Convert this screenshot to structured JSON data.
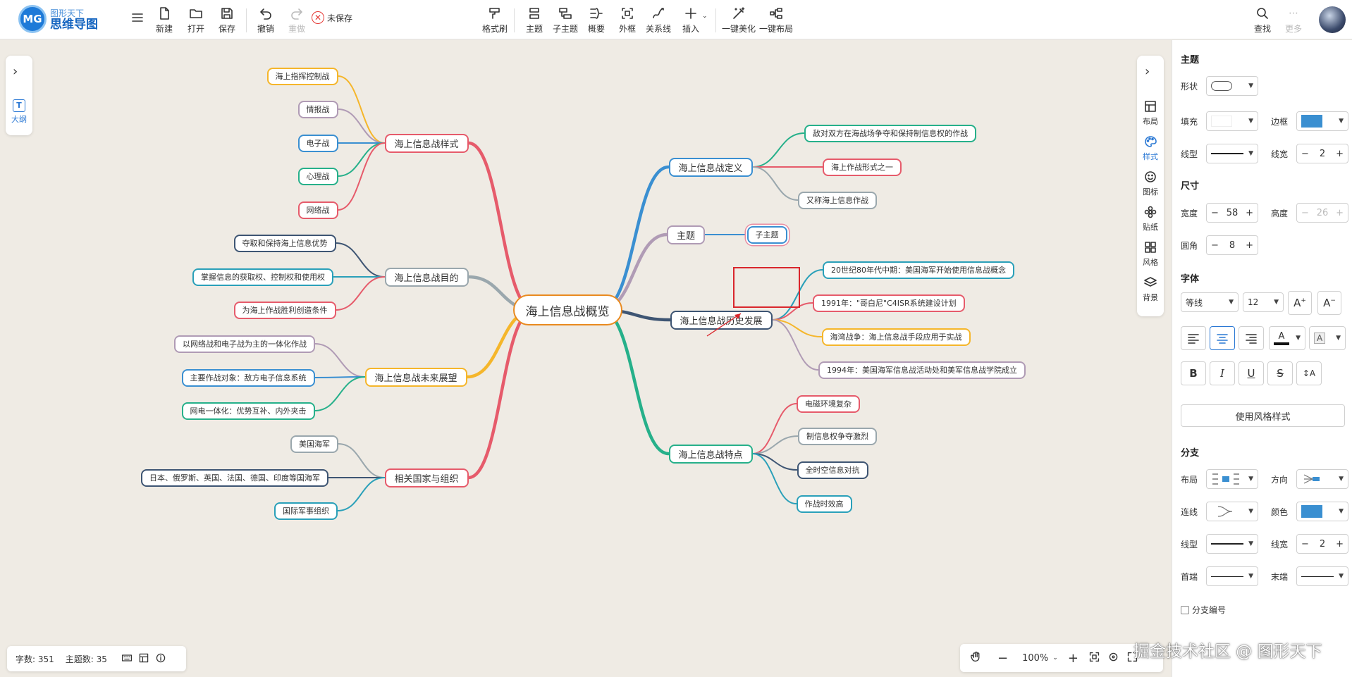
{
  "app": {
    "logo_mark": "MG",
    "logo_line1": "图形天下",
    "logo_line2": "思维导图"
  },
  "toolbar": {
    "new": "新建",
    "open": "打开",
    "save": "保存",
    "undo": "撤销",
    "redo": "重做",
    "unsaved": "未保存",
    "format_painter": "格式刷",
    "topic": "主题",
    "subtopic": "子主题",
    "summary": "概要",
    "boundary": "外框",
    "relation": "关系线",
    "insert": "插入",
    "beautify": "一键美化",
    "auto_layout": "一键布局",
    "search": "查找",
    "more": "更多"
  },
  "left_panel": {
    "outline": "大纲"
  },
  "right_tabs": {
    "layout": "布局",
    "style": "样式",
    "icon": "图标",
    "sticker": "贴纸",
    "theme": "风格",
    "background": "背景"
  },
  "mindmap": {
    "root": "海上信息战概览",
    "left_branches": [
      {
        "label": "海上信息战样式",
        "color": "#e65b6b",
        "children": [
          "海上指挥控制战",
          "情报战",
          "电子战",
          "心理战",
          "网络战"
        ],
        "child_colors": [
          "#f5b62b",
          "#b09bb5",
          "#3a8fd1",
          "#26b08a",
          "#e65b6b"
        ]
      },
      {
        "label": "海上信息战目的",
        "color": "#9aa7ad",
        "children": [
          "夺取和保持海上信息优势",
          "掌握信息的获取权、控制权和使用权",
          "为海上作战胜利创造条件"
        ],
        "child_colors": [
          "#3e5573",
          "#2aa0b9",
          "#e65b6b"
        ]
      },
      {
        "label": "海上信息战未来展望",
        "color": "#f5b62b",
        "children": [
          "以网络战和电子战为主的一体化作战",
          "主要作战对象：敌方电子信息系统",
          "网电一体化：优势互补、内外夹击"
        ],
        "child_colors": [
          "#b09bb5",
          "#3a8fd1",
          "#26b08a"
        ]
      },
      {
        "label": "相关国家与组织",
        "color": "#e65b6b",
        "children": [
          "美国海军",
          "日本、俄罗斯、英国、法国、德国、印度等国海军",
          "国际军事组织"
        ],
        "child_colors": [
          "#9aa7ad",
          "#3e5573",
          "#2aa0b9"
        ]
      }
    ],
    "right_branches": [
      {
        "label": "海上信息战定义",
        "color": "#3a8fd1",
        "children": [
          "敌对双方在海战场争夺和保持制信息权的作战",
          "海上作战形式之一",
          "又称海上信息作战"
        ],
        "child_colors": [
          "#26b08a",
          "#e65b6b",
          "#9aa7ad"
        ]
      },
      {
        "label": "主题",
        "color": "#b09bb5",
        "children": [
          "子主题"
        ],
        "child_colors": [
          "#3a8fd1"
        ]
      },
      {
        "label": "海上信息战历史发展",
        "color": "#3e5573",
        "children": [
          "20世纪80年代中期：美国海军开始使用信息战概念",
          "1991年：\"哥白尼\"C4ISR系统建设计划",
          "海湾战争：海上信息战手段应用于实战",
          "1994年：美国海军信息战活动处和美军信息战学院成立"
        ],
        "child_colors": [
          "#2aa0b9",
          "#e65b6b",
          "#f5b62b",
          "#b09bb5"
        ]
      },
      {
        "label": "海上信息战特点",
        "color": "#26b08a",
        "children": [
          "电磁环境复杂",
          "制信息权争夺激烈",
          "全时空信息对抗",
          "作战时效高"
        ],
        "child_colors": [
          "#e65b6b",
          "#9aa7ad",
          "#3e5573",
          "#2aa0b9"
        ]
      }
    ]
  },
  "props": {
    "theme_title": "主题",
    "shape_label": "形状",
    "fill_label": "填充",
    "border_label": "边框",
    "border_color": "#3a8fd1",
    "line_style_label": "线型",
    "line_width_label": "线宽",
    "line_width_value": "2",
    "size_title": "尺寸",
    "width_label": "宽度",
    "width_value": "58",
    "height_label": "高度",
    "height_value": "26",
    "radius_label": "圆角",
    "radius_value": "8",
    "font_title": "字体",
    "font_family": "等线",
    "font_size": "12",
    "apply_style": "使用风格样式",
    "branch_title": "分支",
    "layout_label": "布局",
    "direction_label": "方向",
    "connector_label": "连线",
    "color_label": "颜色",
    "branch_color": "#3a8fd1",
    "branch_line_style_label": "线型",
    "branch_line_width_label": "线宽",
    "branch_line_width_value": "2",
    "start_label": "首端",
    "end_label": "末端",
    "numbering_label": "分支编号"
  },
  "status": {
    "word_count": "字数: 351",
    "topic_count": "主题数: 35"
  },
  "zoom": {
    "level": "100%"
  },
  "watermark": "掘金技术社区 @ 图形天下",
  "colors": {
    "accent": "#1e7ad8",
    "root_border": "#e98a1f",
    "highlight_box": "#d9262c"
  }
}
